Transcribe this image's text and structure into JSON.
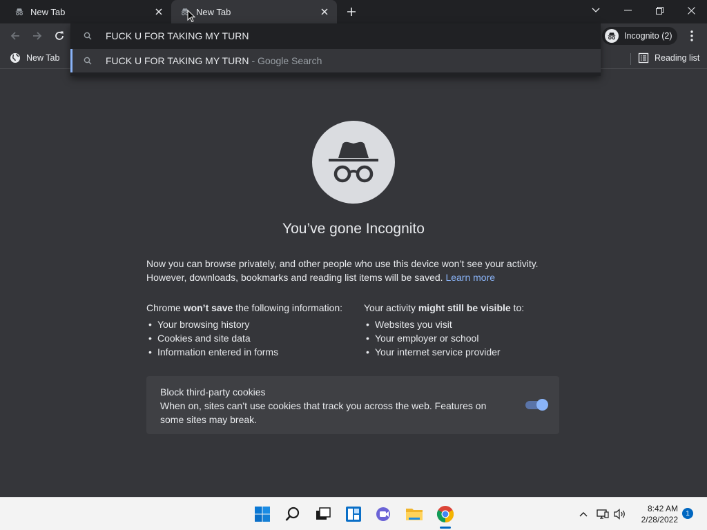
{
  "tabs": [
    {
      "label": "New Tab",
      "icon": "incognito-icon"
    },
    {
      "label": "New Tab",
      "icon": "incognito-icon"
    }
  ],
  "toolbar": {
    "profile_label": "Incognito (2)"
  },
  "omnibox": {
    "query": "FUCK U FOR TAKING MY TURN",
    "suggestion": "FUCK U FOR TAKING MY TURN",
    "suggestion_suffix": "- Google Search"
  },
  "bookmarks": {
    "item_label": "New Tab",
    "reading_list_label": "Reading list"
  },
  "main": {
    "headline": "You’ve gone Incognito",
    "intro_text": "Now you can browse privately, and other people who use this device won’t see your activity. However, downloads, bookmarks and reading list items will be saved.",
    "learn_more": "Learn more",
    "left_column": {
      "title_pre": "Chrome ",
      "title_bold": "won’t save",
      "title_post": " the following information:",
      "items": [
        "Your browsing history",
        "Cookies and site data",
        "Information entered in forms"
      ]
    },
    "right_column": {
      "title_pre": "Your activity ",
      "title_bold": "might still be visible",
      "title_post": " to:",
      "items": [
        "Websites you visit",
        "Your employer or school",
        "Your internet service provider"
      ]
    },
    "cookie_card": {
      "title": "Block third-party cookies",
      "description": "When on, sites can’t use cookies that track you across the web. Features on some sites may break.",
      "toggle_on": true
    }
  },
  "taskbar": {
    "time": "8:42 AM",
    "date": "2/28/2022",
    "notification_count": "1"
  },
  "colors": {
    "accent": "#8ab4f8",
    "frame": "#202124",
    "page_bg": "#35363a"
  }
}
